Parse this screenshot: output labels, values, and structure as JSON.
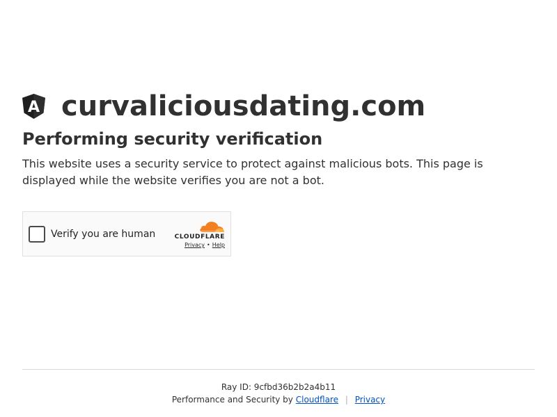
{
  "site": {
    "title": "curvaliciousdating.com",
    "logo_icon": "angular-shield-icon",
    "logo_letter": "A"
  },
  "page": {
    "heading": "Performing security verification",
    "description": "This website uses a security service to protect against malicious bots. This page is displayed while the website verifies you are not a bot."
  },
  "widget": {
    "checkbox_checked": false,
    "label": "Verify you are human",
    "brand_icon": "cloudflare-cloud-icon",
    "brand_name": "CLOUDFLARE",
    "privacy_link": "Privacy",
    "separator": "•",
    "help_link": "Help"
  },
  "footer": {
    "ray_id": "Ray ID: 9cfbd36b2b2a4b11",
    "performance_text": "Performance and Security by",
    "cloudflare_link": "Cloudflare",
    "separator": "|",
    "privacy_link": "Privacy"
  },
  "colors": {
    "text": "#313131",
    "link": "#0051c3",
    "cloudflare_orange": "#f38020",
    "cloudflare_light_orange": "#fbad41"
  }
}
